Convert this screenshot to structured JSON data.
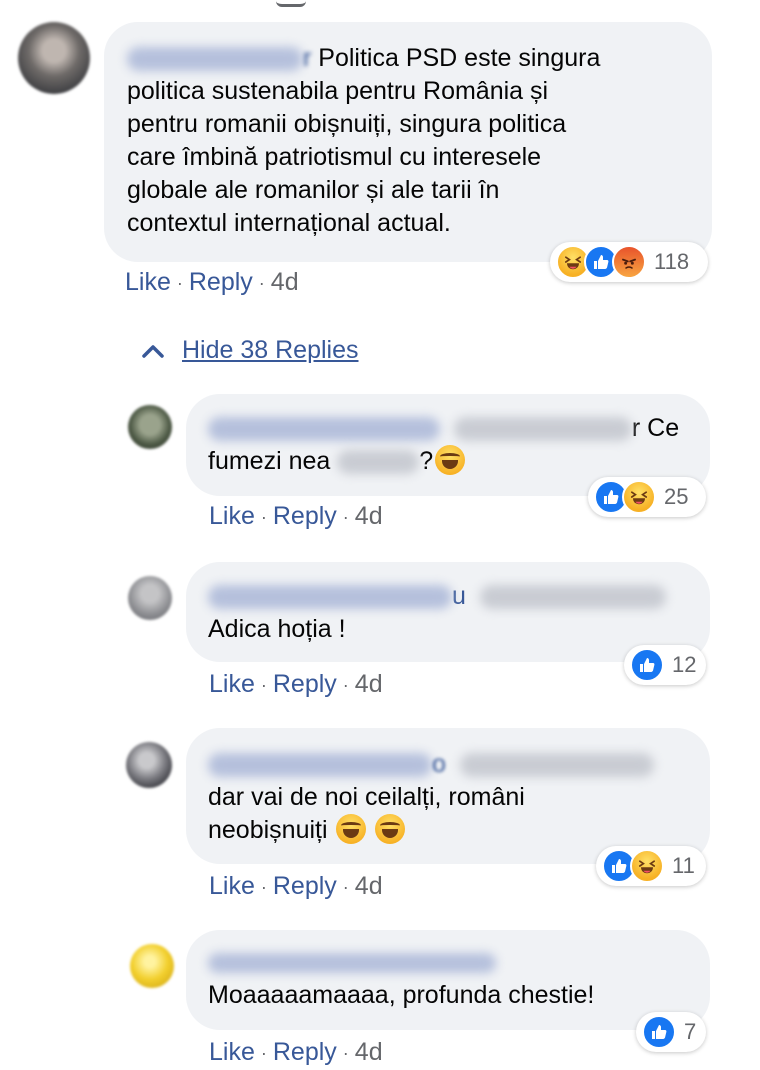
{
  "main_comment": {
    "text_lines": [
      "Politica PSD este singura",
      "politica sustenabila pentru România și",
      "pentru romanii obișnuiți, singura politica",
      "care îmbină patriotismul cu interesele",
      "globale ale romanilor și ale tarii în",
      "contextul internațional actual."
    ],
    "actions": {
      "like": "Like",
      "reply": "Reply",
      "time": "4d"
    },
    "reactions": {
      "icons": [
        "haha-icon",
        "like-icon",
        "angry-icon"
      ],
      "count": "118"
    }
  },
  "toggle": {
    "label": "Hide 38 Replies",
    "icon": "chevron-up-icon"
  },
  "replies": [
    {
      "line1_tail": "r Ce",
      "line2_head": "fumezi nea",
      "line2_tail": "?",
      "actions": {
        "like": "Like",
        "reply": "Reply",
        "time": "4d"
      },
      "reactions": {
        "icons": [
          "like-icon",
          "haha-icon"
        ],
        "count": "25"
      }
    },
    {
      "name_tail": "u",
      "text": "Adica hoția !",
      "actions": {
        "like": "Like",
        "reply": "Reply",
        "time": "4d"
      },
      "reactions": {
        "icons": [
          "like-icon"
        ],
        "count": "12"
      }
    },
    {
      "name_tail": "o",
      "text_lines": [
        "dar vai de noi ceilalți, români",
        "neobișnuiți"
      ],
      "actions": {
        "like": "Like",
        "reply": "Reply",
        "time": "4d"
      },
      "reactions": {
        "icons": [
          "like-icon",
          "haha-icon"
        ],
        "count": "11"
      }
    },
    {
      "text": "Moaaaaamaaaa, profunda chestie!",
      "actions": {
        "like": "Like",
        "reply": "Reply",
        "time": "4d"
      },
      "reactions": {
        "icons": [
          "like-icon"
        ],
        "count": "7"
      }
    }
  ],
  "colors": {
    "link": "#385898",
    "bubble": "#f0f2f5",
    "muted": "#65676b",
    "like": "#1877f2"
  }
}
